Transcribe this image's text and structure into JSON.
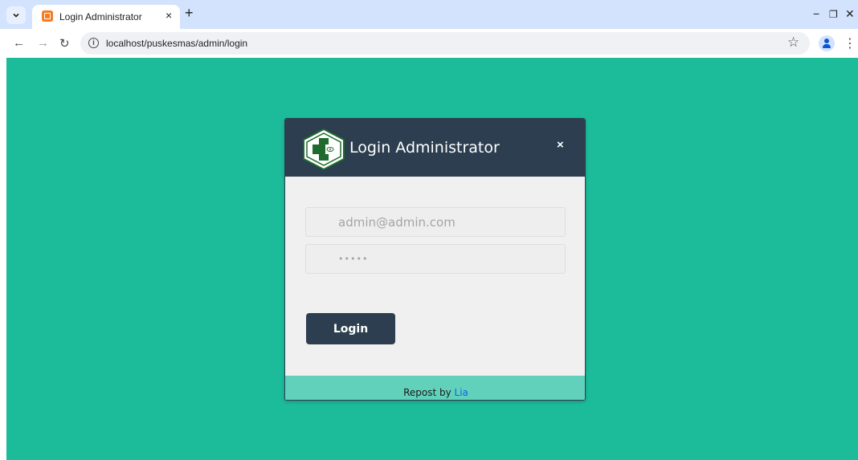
{
  "browser": {
    "tab_title": "Login Administrator",
    "tab_close": "×",
    "new_tab": "+",
    "url": "localhost/puskesmas/admin/login",
    "window_controls": {
      "minimize": "−",
      "restore": "❐",
      "close": "✕"
    },
    "icons": [
      "tab-search-icon",
      "favicon-icon",
      "back-icon",
      "forward-icon",
      "reload-icon",
      "info-icon",
      "bookmark-star-icon",
      "profile-icon",
      "menu-icon"
    ]
  },
  "modal": {
    "title": "Login Administrator",
    "close_label": "×",
    "email_placeholder": "admin@admin.com",
    "password_placeholder": "•••••",
    "login_label": "Login",
    "footer": {
      "prefix": "Repost by ",
      "link_text": "Lia"
    }
  },
  "colors": {
    "page_background": "#1cbc9a",
    "header": "#2c3e50",
    "footer": "#62d1bc",
    "link": "#0a66e4"
  }
}
